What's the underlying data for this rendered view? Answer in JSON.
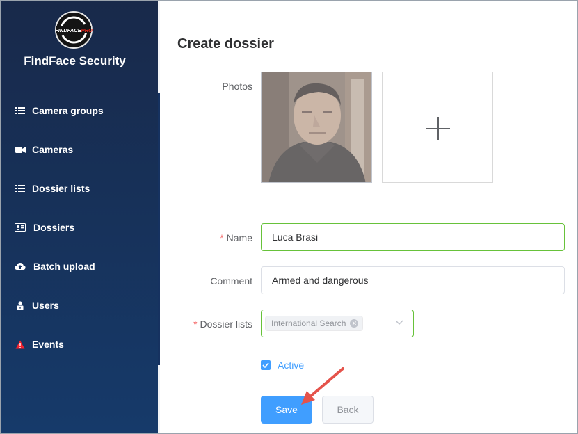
{
  "app": {
    "logo_text": "FINDFACEPRO",
    "brand_name": "FindFace Security"
  },
  "sidebar": {
    "items": [
      {
        "label": "Camera groups",
        "icon": "list-icon"
      },
      {
        "label": "Cameras",
        "icon": "video-camera-icon"
      },
      {
        "label": "Dossier lists",
        "icon": "list-icon"
      },
      {
        "label": "Dossiers",
        "icon": "id-card-icon"
      },
      {
        "label": "Batch upload",
        "icon": "cloud-upload-icon"
      },
      {
        "label": "Users",
        "icon": "user-lock-icon"
      },
      {
        "label": "Events",
        "icon": "warning-icon"
      }
    ]
  },
  "main": {
    "title": "Create dossier",
    "photos_label": "Photos",
    "name_label": "Name",
    "name_value": "Luca Brasi",
    "comment_label": "Comment",
    "comment_value": "Armed and dangerous",
    "dossier_lists_label": "Dossier lists",
    "dossier_list_tag": "International Search",
    "active_label": "Active",
    "active_checked": true,
    "save_label": "Save",
    "back_label": "Back"
  },
  "colors": {
    "sidebar_top": "#18294a",
    "sidebar_bottom": "#163a6a",
    "primary": "#409eff",
    "success_border": "#67c23a",
    "required": "#f56c6c",
    "events_icon": "#f5222d",
    "annotation_arrow": "#e5534b"
  }
}
